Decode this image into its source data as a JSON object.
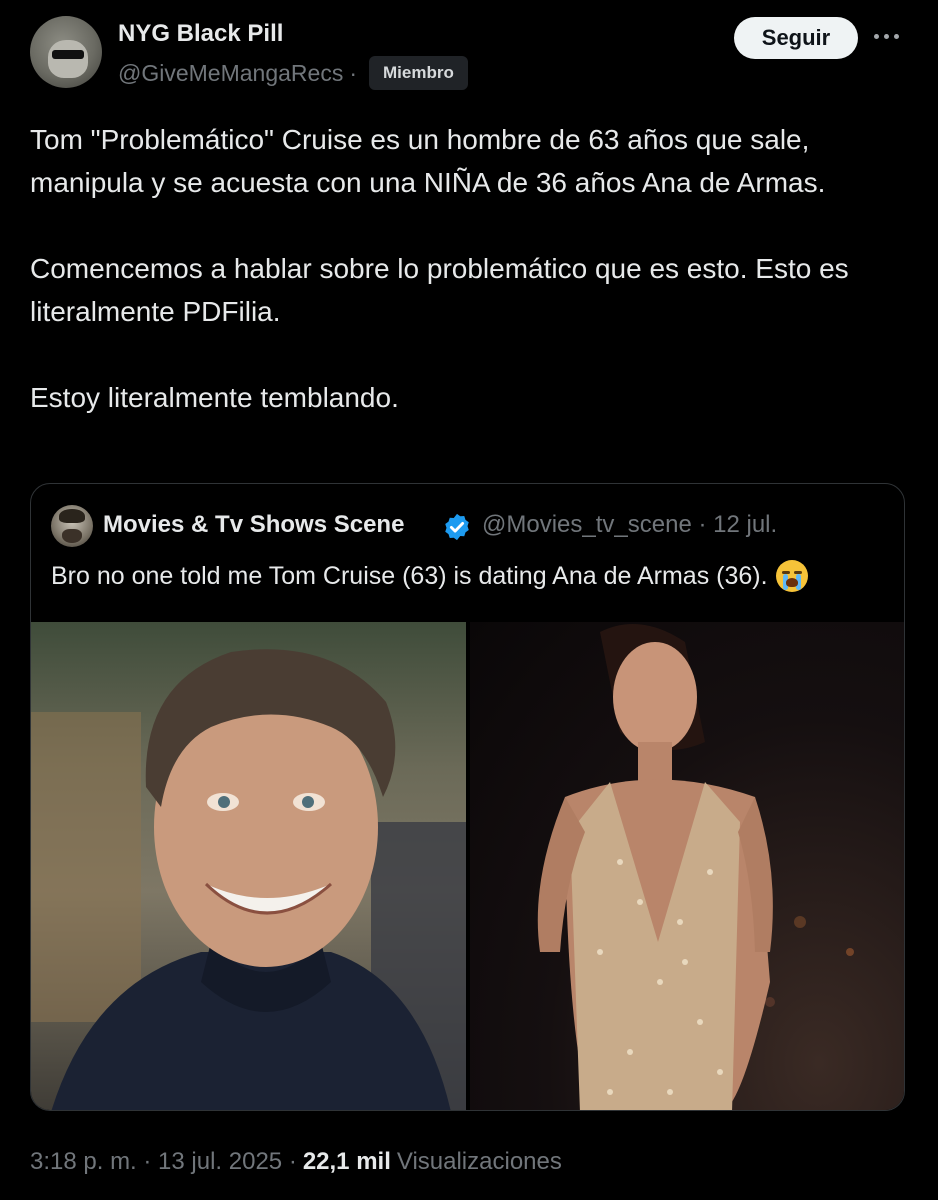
{
  "author": {
    "display_name": "NYG Black Pill",
    "handle": "@GiveMeMangaRecs",
    "separator": "·",
    "badge": "Miembro",
    "avatar_icon": "dog-with-sunglasses-avatar"
  },
  "actions": {
    "follow_label": "Seguir",
    "more_icon": "more-horizontal-icon"
  },
  "tweet": {
    "paragraphs": [
      "Tom \"Problemático\" Cruise es un hombre de 63 años que sale, manipula y se acuesta con una NIÑA de 36 años Ana de Armas.",
      "Comencemos a hablar sobre lo problemático que es esto. Esto es literalmente PDFilia.",
      "Estoy literalmente temblando."
    ]
  },
  "quote": {
    "display_name": "Movies & Tv Shows Scene",
    "verified": true,
    "handle_date": "@Movies_tv_scene · 12 jul.",
    "text": "Bro no one told me Tom Cruise (63) is dating Ana de Armas (36).",
    "emoji": "loudly-crying-face-icon",
    "accent_color": "#1d9bf0"
  },
  "meta": {
    "time_date": "3:18 p. m. · 13 jul. 2025 ·",
    "views_count": "22,1 mil",
    "views_label": "Visualizaciones"
  },
  "colors": {
    "background": "#000000",
    "text": "#e7e9ea",
    "muted": "#71767b",
    "border": "#2f3336",
    "button_bg": "#eff3f4"
  }
}
